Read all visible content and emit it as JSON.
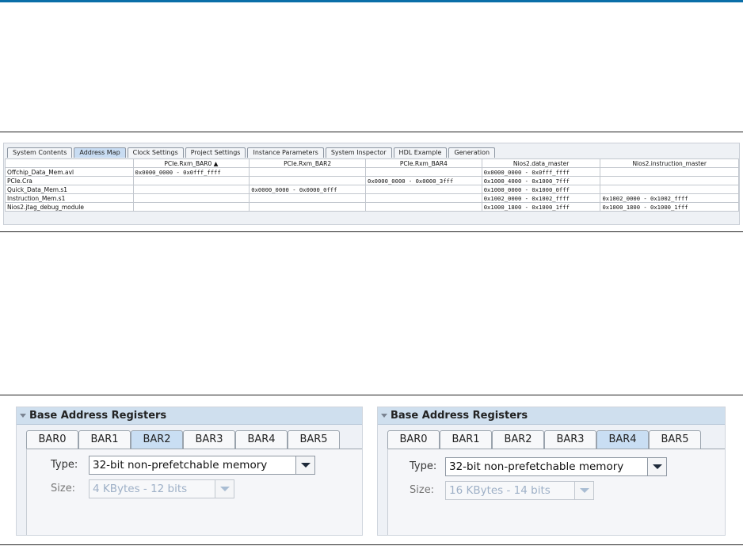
{
  "address_map": {
    "tabs": [
      {
        "label": "System Contents",
        "active": false
      },
      {
        "label": "Address Map",
        "active": true
      },
      {
        "label": "Clock Settings",
        "active": false
      },
      {
        "label": "Project Settings",
        "active": false
      },
      {
        "label": "Instance Parameters",
        "active": false
      },
      {
        "label": "System Inspector",
        "active": false
      },
      {
        "label": "HDL Example",
        "active": false
      },
      {
        "label": "Generation",
        "active": false
      }
    ],
    "columns": [
      "",
      "PCIe.Rxm_BAR0 ▲",
      "PCIe.Rxm_BAR2",
      "PCIe.Rxm_BAR4",
      "Nios2.data_master",
      "Nios2.instruction_master"
    ],
    "rows": [
      [
        "Offchip_Data_Mem.avl",
        "0x0000_0000 - 0x0fff_ffff",
        "",
        "",
        "0x0000_0000 - 0x0fff_ffff",
        ""
      ],
      [
        "PCIe.Cra",
        "",
        "",
        "0x0000_0000 - 0x0000_3fff",
        "0x1000_4000 - 0x1000_7fff",
        ""
      ],
      [
        "Quick_Data_Mem.s1",
        "",
        "0x0000_0000 - 0x0000_0fff",
        "",
        "0x1000_0000 - 0x1000_0fff",
        ""
      ],
      [
        "Instruction_Mem.s1",
        "",
        "",
        "",
        "0x1002_0000 - 0x1002_ffff",
        "0x1002_0000 - 0x1002_ffff"
      ],
      [
        "Nios2.jtag_debug_module",
        "",
        "",
        "",
        "0x1000_1800 - 0x1000_1fff",
        "0x1000_1800 - 0x1000_1fff"
      ]
    ]
  },
  "bar_left": {
    "title": "Base Address Registers",
    "tabs": [
      "BAR0",
      "BAR1",
      "BAR2",
      "BAR3",
      "BAR4",
      "BAR5"
    ],
    "active_tab": "BAR2",
    "type_label": "Type:",
    "type_value": "32-bit non-prefetchable memory",
    "size_label": "Size:",
    "size_value": "4 KBytes - 12 bits"
  },
  "bar_right": {
    "title": "Base Address Registers",
    "tabs": [
      "BAR0",
      "BAR1",
      "BAR2",
      "BAR3",
      "BAR4",
      "BAR5"
    ],
    "active_tab": "BAR4",
    "type_label": "Type:",
    "type_value": "32-bit non-prefetchable memory",
    "size_label": "Size:",
    "size_value": "16 KBytes - 14 bits"
  },
  "colors": {
    "accent_rule": "#0a6ea8",
    "active_tab": "#c8dcf2",
    "section_header": "#cfdfee"
  }
}
